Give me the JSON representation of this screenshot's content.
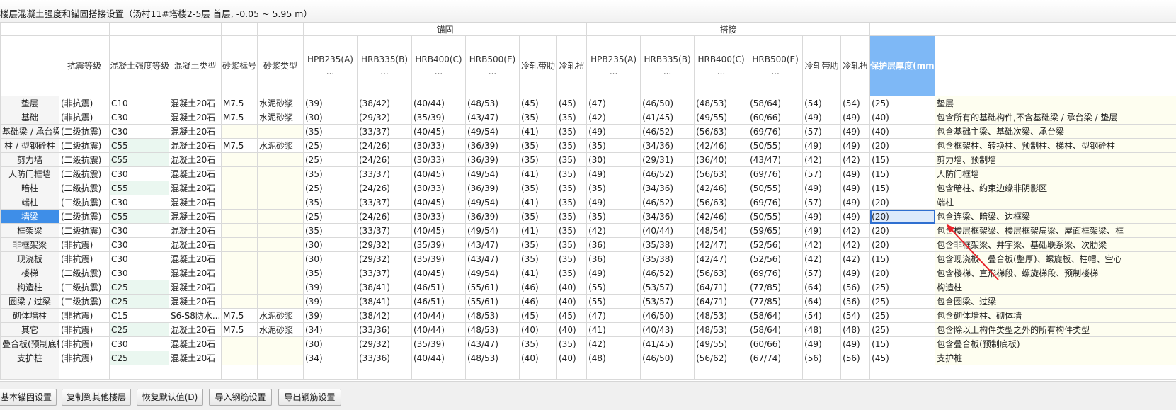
{
  "window": {
    "title": "楼层混凝土强度和锚固搭接设置（汤村11#塔楼2-5层  首层, -0.05 ~ 5.95 m）"
  },
  "grid": {
    "group_headers": {
      "anchor": "锚固",
      "lap": "搭接"
    },
    "columns": {
      "seismic": "抗震等级",
      "concrete_grade": "混凝土强度等级",
      "concrete_type": "混凝土类型",
      "mortar_grade": "砂浆标号",
      "mortar_type": "砂浆类型",
      "hpb235": "HPB235(A)\n...",
      "hrb335": "HRB335(B)\n...",
      "hrb400": "HRB400(C)\n...",
      "hrb500": "HRB500(E)\n...",
      "cold_ribbed": "冷轧带肋",
      "cold_twisted": "冷轧扭",
      "cover": "保护层厚度(mm)"
    },
    "rows": [
      {
        "name": "垫层",
        "cells": [
          "(非抗震)",
          "C10",
          "混凝土20石",
          "M7.5",
          "水泥砂浆",
          "(39)",
          "(38/42)",
          "(40/44)",
          "(48/53)",
          "(45)",
          "(45)",
          "(47)",
          "(46/50)",
          "(48/53)",
          "(58/64)",
          "(54)",
          "(54)",
          "(25)",
          "垫层"
        ]
      },
      {
        "name": "基础",
        "cells": [
          "(非抗震)",
          "C30",
          "混凝土20石",
          "M7.5",
          "水泥砂浆",
          "(30)",
          "(29/32)",
          "(35/39)",
          "(43/47)",
          "(35)",
          "(35)",
          "(42)",
          "(41/45)",
          "(49/55)",
          "(60/66)",
          "(49)",
          "(49)",
          "(40)",
          "包含所有的基础构件,不含基础梁 / 承台梁 / 垫层"
        ]
      },
      {
        "name": "基础梁 / 承台梁",
        "cells": [
          "(二级抗震)",
          "C30",
          "混凝土20石",
          "",
          "",
          "(35)",
          "(33/37)",
          "(40/45)",
          "(49/54)",
          "(41)",
          "(35)",
          "(49)",
          "(46/52)",
          "(56/63)",
          "(69/76)",
          "(57)",
          "(49)",
          "(40)",
          "包含基础主梁、基础次梁、承台梁"
        ]
      },
      {
        "name": "柱 / 型钢砼柱",
        "cells": [
          "(二级抗震)",
          "C55",
          "混凝土20石",
          "M7.5",
          "水泥砂浆",
          "(25)",
          "(24/26)",
          "(30/33)",
          "(36/39)",
          "(35)",
          "(35)",
          "(35)",
          "(34/36)",
          "(42/46)",
          "(50/55)",
          "(49)",
          "(49)",
          "(20)",
          "包含框架柱、转换柱、预制柱、梯柱、型钢砼柱"
        ]
      },
      {
        "name": "剪力墙",
        "cells": [
          "(二级抗震)",
          "C55",
          "混凝土20石",
          "",
          "",
          "(25)",
          "(24/26)",
          "(30/33)",
          "(36/39)",
          "(35)",
          "(35)",
          "(30)",
          "(29/31)",
          "(36/40)",
          "(43/47)",
          "(42)",
          "(42)",
          "(15)",
          "剪力墙、预制墙"
        ]
      },
      {
        "name": "人防门框墙",
        "cells": [
          "(二级抗震)",
          "C30",
          "混凝土20石",
          "",
          "",
          "(35)",
          "(33/37)",
          "(40/45)",
          "(49/54)",
          "(41)",
          "(35)",
          "(49)",
          "(46/52)",
          "(56/63)",
          "(69/76)",
          "(57)",
          "(49)",
          "(15)",
          "人防门框墙"
        ]
      },
      {
        "name": "暗柱",
        "cells": [
          "(二级抗震)",
          "C55",
          "混凝土20石",
          "",
          "",
          "(25)",
          "(24/26)",
          "(30/33)",
          "(36/39)",
          "(35)",
          "(35)",
          "(35)",
          "(34/36)",
          "(42/46)",
          "(50/55)",
          "(49)",
          "(49)",
          "(15)",
          "包含暗柱、约束边缘非阴影区"
        ]
      },
      {
        "name": "端柱",
        "cells": [
          "(二级抗震)",
          "C30",
          "混凝土20石",
          "",
          "",
          "(35)",
          "(33/37)",
          "(40/45)",
          "(49/54)",
          "(41)",
          "(35)",
          "(49)",
          "(46/52)",
          "(56/63)",
          "(69/76)",
          "(57)",
          "(49)",
          "(20)",
          "端柱"
        ]
      },
      {
        "name": "墙梁",
        "cells": [
          "(二级抗震)",
          "C55",
          "混凝土20石",
          "",
          "",
          "(25)",
          "(24/26)",
          "(30/33)",
          "(36/39)",
          "(35)",
          "(35)",
          "(35)",
          "(34/36)",
          "(42/46)",
          "(50/55)",
          "(49)",
          "(49)",
          "(20)",
          "包含连梁、暗梁、边框梁"
        ]
      },
      {
        "name": "框架梁",
        "cells": [
          "(二级抗震)",
          "C30",
          "混凝土20石",
          "",
          "",
          "(35)",
          "(33/37)",
          "(40/45)",
          "(49/54)",
          "(41)",
          "(35)",
          "(42)",
          "(40/44)",
          "(48/54)",
          "(59/65)",
          "(49)",
          "(42)",
          "(20)",
          "包含楼层框架梁、楼层框架扁梁、屋面框架梁、框"
        ]
      },
      {
        "name": "非框架梁",
        "cells": [
          "(非抗震)",
          "C30",
          "混凝土20石",
          "",
          "",
          "(30)",
          "(29/32)",
          "(35/39)",
          "(43/47)",
          "(35)",
          "(35)",
          "(36)",
          "(35/38)",
          "(42/47)",
          "(52/56)",
          "(42)",
          "(42)",
          "(20)",
          "包含非框架梁、井字梁、基础联系梁、次肋梁"
        ]
      },
      {
        "name": "现浇板",
        "cells": [
          "(非抗震)",
          "C30",
          "混凝土20石",
          "",
          "",
          "(30)",
          "(29/32)",
          "(35/39)",
          "(43/47)",
          "(35)",
          "(35)",
          "(36)",
          "(35/38)",
          "(42/47)",
          "(52/56)",
          "(42)",
          "(42)",
          "(15)",
          "包含现浇板、叠合板(整厚)、螺旋板、柱帽、空心"
        ]
      },
      {
        "name": "楼梯",
        "cells": [
          "(二级抗震)",
          "C30",
          "混凝土20石",
          "",
          "",
          "(35)",
          "(33/37)",
          "(40/45)",
          "(49/54)",
          "(41)",
          "(35)",
          "(49)",
          "(46/52)",
          "(56/63)",
          "(69/76)",
          "(57)",
          "(49)",
          "(20)",
          "包含楼梯、直形梯段、螺旋梯段、预制楼梯"
        ]
      },
      {
        "name": "构造柱",
        "cells": [
          "(二级抗震)",
          "C25",
          "混凝土20石",
          "",
          "",
          "(39)",
          "(38/41)",
          "(46/51)",
          "(55/61)",
          "(46)",
          "(40)",
          "(55)",
          "(53/57)",
          "(64/71)",
          "(77/85)",
          "(64)",
          "(56)",
          "(25)",
          "构造柱"
        ]
      },
      {
        "name": "圈梁 / 过梁",
        "cells": [
          "(二级抗震)",
          "C25",
          "混凝土20石",
          "",
          "",
          "(39)",
          "(38/41)",
          "(46/51)",
          "(55/61)",
          "(46)",
          "(40)",
          "(55)",
          "(53/57)",
          "(64/71)",
          "(77/85)",
          "(64)",
          "(56)",
          "(25)",
          "包含圈梁、过梁"
        ]
      },
      {
        "name": "砌体墙柱",
        "cells": [
          "(非抗震)",
          "C15",
          "S6-S8防水...",
          "M7.5",
          "水泥砂浆",
          "(39)",
          "(38/42)",
          "(40/44)",
          "(48/53)",
          "(45)",
          "(45)",
          "(47)",
          "(46/50)",
          "(48/53)",
          "(58/64)",
          "(54)",
          "(54)",
          "(25)",
          "包含砌体墙柱、砌体墙"
        ]
      },
      {
        "name": "其它",
        "cells": [
          "(非抗震)",
          "C25",
          "混凝土20石",
          "M7.5",
          "水泥砂浆",
          "(34)",
          "(33/36)",
          "(40/44)",
          "(48/53)",
          "(40)",
          "(40)",
          "(41)",
          "(40/43)",
          "(48/53)",
          "(58/64)",
          "(48)",
          "(48)",
          "(25)",
          "包含除以上构件类型之外的所有构件类型"
        ]
      },
      {
        "name": "叠合板(预制底板)",
        "cells": [
          "(非抗震)",
          "C30",
          "混凝土20石",
          "",
          "",
          "(30)",
          "(29/32)",
          "(35/39)",
          "(43/47)",
          "(35)",
          "(35)",
          "(42)",
          "(41/45)",
          "(49/55)",
          "(60/66)",
          "(49)",
          "(49)",
          "(15)",
          "包含叠合板(预制底板)"
        ]
      },
      {
        "name": "支护桩",
        "cells": [
          "(非抗震)",
          "C25",
          "混凝土20石",
          "",
          "",
          "(34)",
          "(33/36)",
          "(40/44)",
          "(48/53)",
          "(40)",
          "(40)",
          "(48)",
          "(46/50)",
          "(56/62)",
          "(67/74)",
          "(56)",
          "(56)",
          "(45)",
          "支护桩"
        ]
      },
      {
        "name": "",
        "cells": [
          "",
          "",
          "",
          "",
          "",
          "",
          "",
          "",
          "",
          "",
          "",
          "",
          "",
          "",
          "",
          "",
          "",
          "",
          ""
        ]
      }
    ]
  },
  "selection": {
    "row": "墙梁",
    "cell": "(20)"
  },
  "buttons": {
    "basic_anchor": "基本锚固设置",
    "copy_floors": "复制到其他楼层",
    "restore_default": "恢复默认值(D)",
    "import_rebar": "导入钢筋设置",
    "export_rebar": "导出钢筋设置"
  },
  "colors": {
    "header_highlight": "#7eb8f6",
    "selected_row_name": "#3e8ee8",
    "concrete_grade_bg": "#eaf7f0",
    "description_bg": "#fefef0",
    "annotation_arrow": "#e8242b"
  }
}
